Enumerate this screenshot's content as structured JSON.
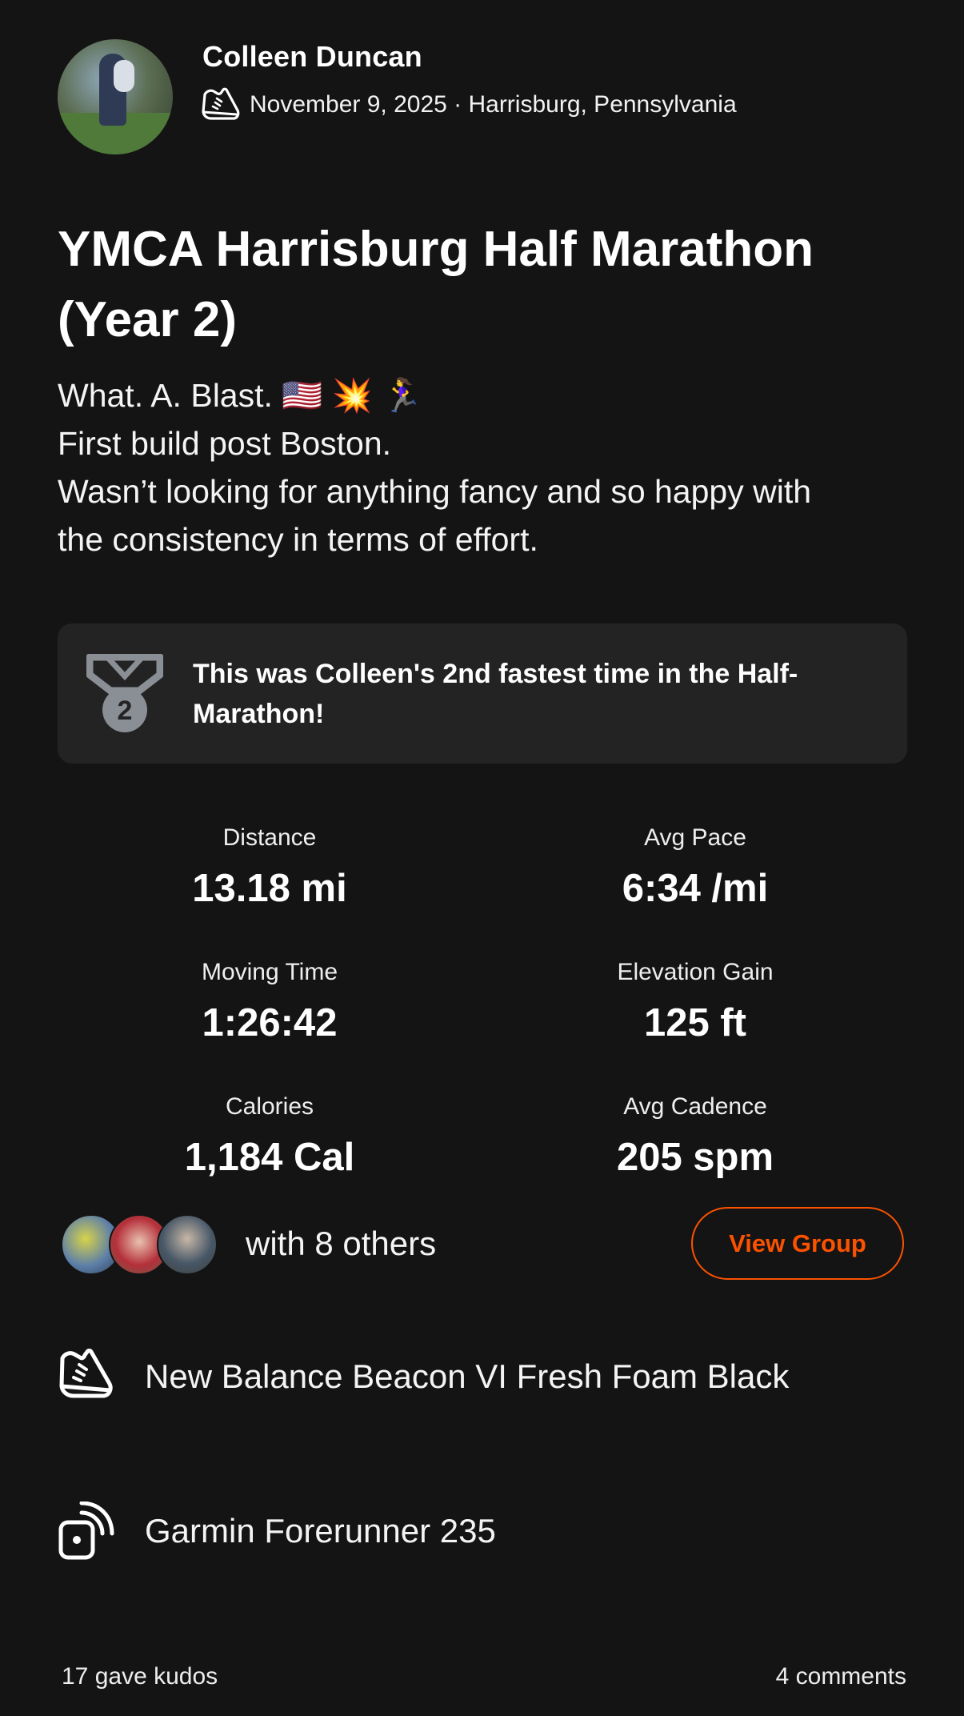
{
  "author": {
    "name": "Colleen Duncan",
    "date_location": "November 9, 2025 · Harrisburg, Pennsylvania",
    "activity_icon": "running-shoe-icon"
  },
  "activity": {
    "title": "YMCA Harrisburg Half Marathon (Year 2)",
    "description_lines": [
      "What. A. Blast. 🇺🇸 💥 🏃‍♀️",
      "First build post Boston.",
      "Wasn’t looking for anything fancy and so happy with",
      "the consistency in terms of effort."
    ]
  },
  "achievement": {
    "text": "This was Colleen's 2nd fastest time in the Half-Marathon!",
    "medal_number": "2",
    "icon": "medal-icon"
  },
  "stats": [
    {
      "label": "Distance",
      "value": "13.18 mi"
    },
    {
      "label": "Avg Pace",
      "value": "6:34 /mi"
    },
    {
      "label": "Moving Time",
      "value": "1:26:42"
    },
    {
      "label": "Elevation Gain",
      "value": "125 ft"
    },
    {
      "label": "Calories",
      "value": "1,184 Cal"
    },
    {
      "label": "Avg Cadence",
      "value": "205 spm"
    }
  ],
  "group": {
    "with_text": "with 8 others",
    "button_label": "View Group"
  },
  "gear": {
    "shoes": "New Balance Beacon VI Fresh Foam Black",
    "device": "Garmin Forerunner 235"
  },
  "footer": {
    "kudos": "17 gave kudos",
    "comments": "4 comments"
  },
  "colors": {
    "background": "#141414",
    "card": "#232323",
    "accent": "#fc5200",
    "text": "#ffffff"
  }
}
